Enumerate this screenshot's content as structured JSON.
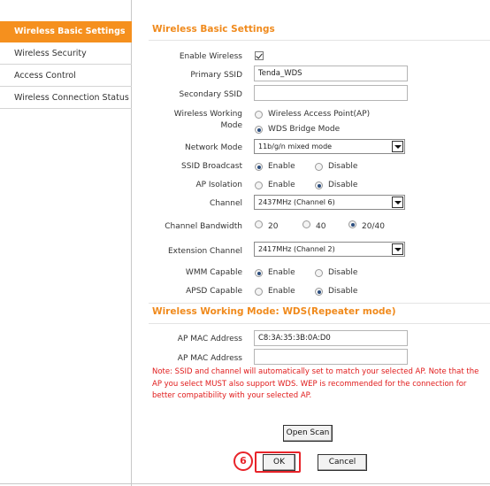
{
  "sidebar": {
    "items": [
      {
        "label": "Wireless Basic Settings",
        "active": true
      },
      {
        "label": "Wireless Security"
      },
      {
        "label": "Access Control"
      },
      {
        "label": "Wireless Connection Status"
      }
    ]
  },
  "basic": {
    "title": "Wireless Basic Settings",
    "enable_wireless_label": "Enable Wireless",
    "primary_ssid_label": "Primary SSID",
    "primary_ssid_value": "Tenda_WDS",
    "secondary_ssid_label": "Secondary SSID",
    "secondary_ssid_value": "",
    "mode_label_1": "Wireless Working",
    "mode_label_2": "Mode",
    "mode_opt_ap": "Wireless Access Point(AP)",
    "mode_opt_wds": "WDS Bridge Mode",
    "network_mode_label": "Network Mode",
    "network_mode_value": "11b/g/n mixed mode",
    "ssid_broadcast_label": "SSID Broadcast",
    "ap_isolation_label": "AP Isolation",
    "enable": "Enable",
    "disable": "Disable",
    "channel_label": "Channel",
    "channel_value": "2437MHz (Channel 6)",
    "bandwidth_label": "Channel Bandwidth",
    "bw_20": "20",
    "bw_40": "40",
    "bw_2040": "20/40",
    "ext_channel_label": "Extension Channel",
    "ext_channel_value": "2417MHz (Channel 2)",
    "wmm_label": "WMM Capable",
    "apsd_label": "APSD Capable"
  },
  "wds": {
    "title": "Wireless Working Mode: WDS(Repeater mode)",
    "mac_label": "AP MAC Address",
    "mac1_value": "C8:3A:35:3B:0A:D0",
    "mac2_value": "",
    "note": "Note: SSID and channel will automatically set to match your selected AP. Note that the AP you select MUST also support WDS. WEP is recommended for the connection for better compatibility with your selected AP."
  },
  "buttons": {
    "open_scan": "Open Scan",
    "ok": "OK",
    "cancel": "Cancel"
  },
  "step_badge": "6",
  "colors": {
    "accent": "#f5901e",
    "note": "#e01b1b",
    "highlight": "#e8242a"
  }
}
